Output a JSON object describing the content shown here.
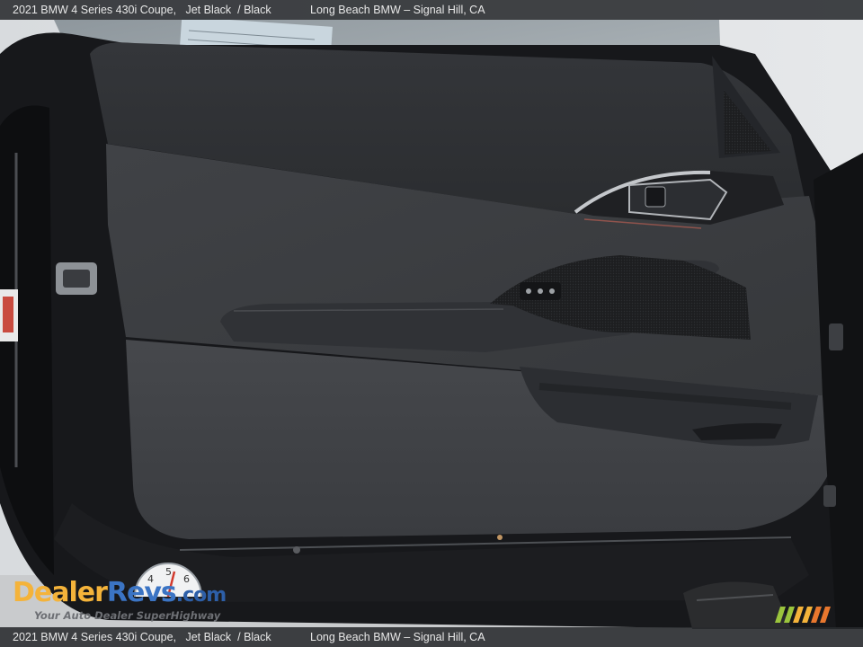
{
  "caption": {
    "vehicle": "2021 BMW 4 Series 430i Coupe,   Jet Black  / Black",
    "dealer": "Long Beach BMW – Signal Hill, CA"
  },
  "logo": {
    "word_1": "Dealer",
    "word_2": "Revs",
    "word_3": ".com",
    "tagline": "Your Auto Dealer SuperHighway",
    "gauge_digits": [
      "4",
      "5",
      "6"
    ]
  },
  "colors": {
    "panel": "#3a3c3f",
    "panel_dark": "#2a2c2f",
    "frame": "#16171a",
    "trim": "#b9bcc0",
    "logo_orange": "#f4b33a",
    "logo_blue": "#3b74c4"
  }
}
